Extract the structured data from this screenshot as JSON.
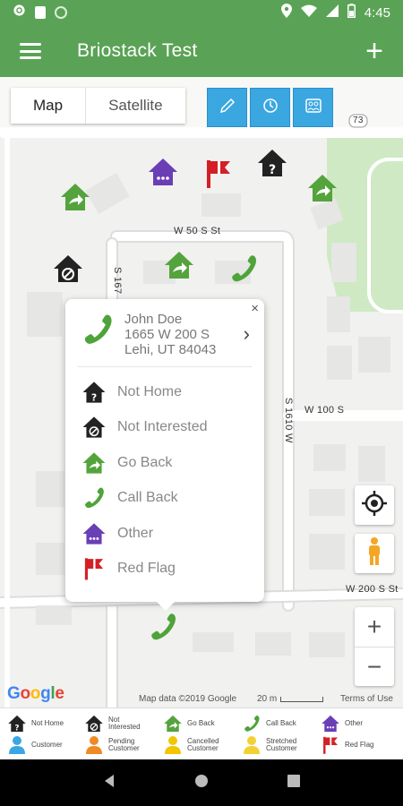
{
  "status_bar": {
    "time": "4:45"
  },
  "app_bar": {
    "title": "Briostack Test",
    "add_label": "+"
  },
  "map": {
    "type_buttons": [
      "Map",
      "Satellite"
    ],
    "road_labels": {
      "w50s": "W 50 S St",
      "s167": "S 167",
      "s1610w": "S 1610 W",
      "w100s": "W 100 S",
      "w200s": "W 200 S St",
      "route": "73"
    },
    "attribution": "Map data ©2019 Google",
    "scale": "20 m",
    "terms": "Terms of Use",
    "google_logo": [
      "G",
      "o",
      "o",
      "g",
      "l",
      "e"
    ],
    "google_colors": [
      "#4285f4",
      "#ea4335",
      "#fbbc05",
      "#4285f4",
      "#34a853",
      "#ea4335"
    ]
  },
  "popup": {
    "name": "John Doe",
    "street": "1665 W 200 S",
    "city": "Lehi, UT 84043",
    "close": "×",
    "options": [
      "Not Home",
      "Not Interested",
      "Go Back",
      "Call Back",
      "Other",
      "Red Flag"
    ]
  },
  "zoom": {
    "in": "+",
    "out": "−"
  },
  "legend": {
    "row1": [
      "Not Home",
      "Not Interested",
      "Go Back",
      "Call Back",
      "Other"
    ],
    "row2": [
      "Customer",
      "Pending Customer",
      "Cancelled Customer",
      "Stretched Customer",
      "Red Flag"
    ]
  },
  "colors": {
    "brand_green": "#5aa356",
    "tool_blue": "#3ba7e1",
    "other_purple": "#6a3fb5",
    "red_flag": "#d32027",
    "customer_blue": "#3ba7e1",
    "pending_orange": "#f08a24",
    "cancelled_yellow": "#f2c500"
  }
}
